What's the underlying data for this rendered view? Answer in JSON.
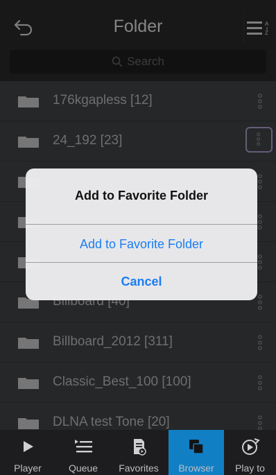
{
  "header": {
    "title": "Folder",
    "search_placeholder": "Search"
  },
  "folders": [
    {
      "label": "176kgapless [12]"
    },
    {
      "label": "24_192 [23]"
    },
    {
      "label": ""
    },
    {
      "label": ""
    },
    {
      "label": ""
    },
    {
      "label": "Billboard [40]"
    },
    {
      "label": "Billboard_2012 [311]"
    },
    {
      "label": "Classic_Best_100 [100]"
    },
    {
      "label": "DLNA test Tone [20]"
    }
  ],
  "dialog": {
    "title": "Add to Favorite Folder",
    "option": "Add to Favorite Folder",
    "cancel": "Cancel"
  },
  "tabs": [
    {
      "label": "Player",
      "icon": "play-icon"
    },
    {
      "label": "Queue",
      "icon": "queue-icon"
    },
    {
      "label": "Favorites",
      "icon": "favorites-icon"
    },
    {
      "label": "Browser",
      "icon": "browser-icon",
      "active": true
    },
    {
      "label": "Play to",
      "icon": "play-to-icon"
    }
  ],
  "colors": {
    "accent": "#117fc4",
    "link": "#1a7df1",
    "background": "#46484b"
  }
}
